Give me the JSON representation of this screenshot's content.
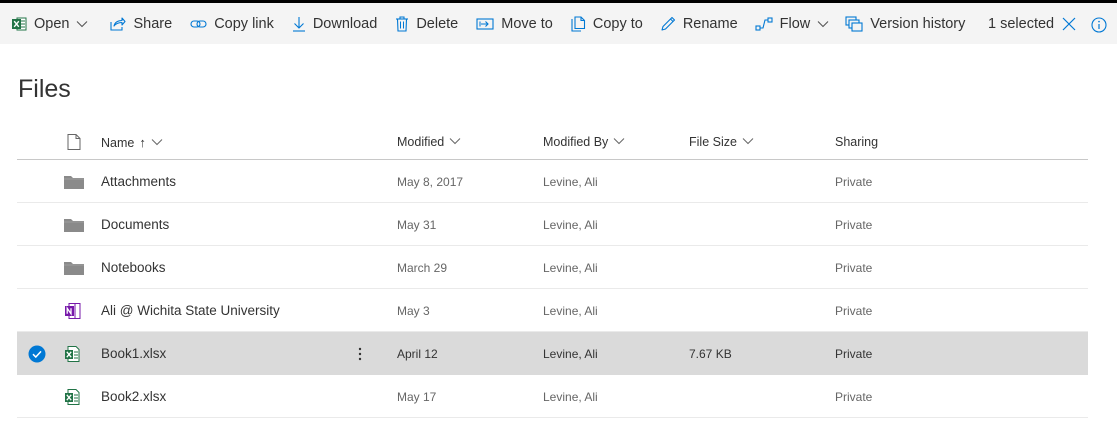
{
  "commandbar": {
    "open": "Open",
    "share": "Share",
    "copy_link": "Copy link",
    "download": "Download",
    "delete": "Delete",
    "move_to": "Move to",
    "copy_to": "Copy to",
    "rename": "Rename",
    "flow": "Flow",
    "version_history": "Version history",
    "selected": "1 selected"
  },
  "page": {
    "title": "Files"
  },
  "table": {
    "columns": {
      "name": "Name",
      "sort_arrow": "↑",
      "modified": "Modified",
      "modified_by": "Modified By",
      "file_size": "File Size",
      "sharing": "Sharing"
    },
    "rows": [
      {
        "type": "folder",
        "name": "Attachments",
        "modified": "May 8, 2017",
        "modified_by": "Levine, Ali",
        "size": "",
        "sharing": "Private",
        "selected": false
      },
      {
        "type": "folder",
        "name": "Documents",
        "modified": "May 31",
        "modified_by": "Levine, Ali",
        "size": "",
        "sharing": "Private",
        "selected": false
      },
      {
        "type": "folder",
        "name": "Notebooks",
        "modified": "March 29",
        "modified_by": "Levine, Ali",
        "size": "",
        "sharing": "Private",
        "selected": false
      },
      {
        "type": "onenote",
        "name": "Ali @ Wichita State University",
        "modified": "May 3",
        "modified_by": "Levine, Ali",
        "size": "",
        "sharing": "Private",
        "selected": false
      },
      {
        "type": "excel",
        "name": "Book1.xlsx",
        "modified": "April 12",
        "modified_by": "Levine, Ali",
        "size": "7.67 KB",
        "sharing": "Private",
        "selected": true
      },
      {
        "type": "excel",
        "name": "Book2.xlsx",
        "modified": "May 17",
        "modified_by": "Levine, Ali",
        "size": "",
        "sharing": "Private",
        "selected": false
      }
    ]
  },
  "colors": {
    "excel_green": "#217346",
    "onenote_purple": "#7719aa",
    "accent_blue": "#0078d4",
    "folder_gray": "#8a8a8a",
    "selected_row": "#dadada",
    "commandbar_bg": "#f4f4f4"
  }
}
